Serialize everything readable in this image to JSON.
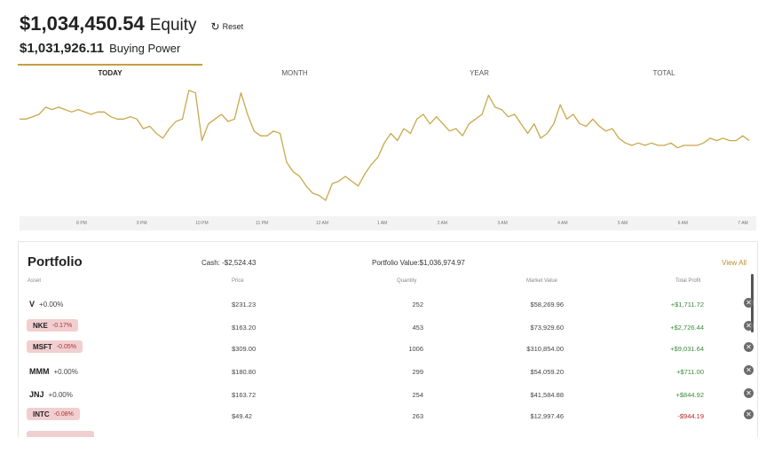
{
  "header": {
    "equity_value": "$1,034,450.54",
    "equity_label": "Equity",
    "reset_label": "Reset",
    "buying_power_value": "$1,031,926.11",
    "buying_power_label": "Buying Power"
  },
  "tabs": [
    {
      "label": "TODAY",
      "active": true
    },
    {
      "label": "MONTH",
      "active": false
    },
    {
      "label": "YEAR",
      "active": false
    },
    {
      "label": "TOTAL",
      "active": false
    }
  ],
  "chart_data": {
    "type": "line",
    "x": [
      "8 PM",
      "9 PM",
      "10 PM",
      "11 PM",
      "12 AM",
      "1 AM",
      "2 AM",
      "3 AM",
      "4 AM",
      "5 AM",
      "6 AM",
      "7 AM"
    ],
    "values": [
      40,
      40,
      41,
      42,
      45,
      44,
      45,
      44,
      43,
      44,
      43,
      42,
      43,
      43,
      41,
      40,
      40,
      41,
      40,
      36,
      37,
      34,
      32,
      36,
      39,
      40,
      52,
      51,
      31,
      38,
      40,
      42,
      39,
      40,
      51,
      42,
      35,
      33,
      33,
      35,
      34,
      22,
      18,
      16,
      12,
      9,
      8,
      6,
      13,
      14,
      16,
      14,
      12,
      17,
      21,
      24,
      30,
      34,
      31,
      36,
      34,
      40,
      42,
      38,
      41,
      38,
      35,
      36,
      33,
      38,
      40,
      42,
      50,
      45,
      44,
      41,
      42,
      38,
      34,
      38,
      32,
      34,
      38,
      46,
      40,
      42,
      38,
      37,
      40,
      37,
      35,
      36,
      32,
      30,
      29,
      30,
      29,
      30,
      29,
      29,
      30,
      28,
      29,
      29,
      29,
      30,
      32,
      31,
      32,
      31,
      31,
      33,
      31
    ],
    "color": "#c9a84c",
    "title": "",
    "xlabel": "",
    "ylabel": ""
  },
  "portfolio": {
    "title": "Portfolio",
    "cash": "Cash: -$2,524.43",
    "value": "Portfolio Value:$1,036,974.97",
    "view_all": "View All",
    "columns": {
      "asset": "Asset",
      "price": "Price",
      "quantity": "Quantity",
      "market_value": "Market Value",
      "total_profit": "Total Profit"
    },
    "rows": [
      {
        "symbol": "V",
        "change": "+0.00%",
        "highlight": false,
        "price": "$231.23",
        "quantity": "252",
        "market_value": "$58,269.96",
        "total_profit": "+$1,711.72",
        "profit_positive": true
      },
      {
        "symbol": "NKE",
        "change": "-0.17%",
        "highlight": true,
        "price": "$163.20",
        "quantity": "453",
        "market_value": "$73,929.60",
        "total_profit": "+$2,726.44",
        "profit_positive": true
      },
      {
        "symbol": "MSFT",
        "change": "-0.05%",
        "highlight": true,
        "price": "$309.00",
        "quantity": "1006",
        "market_value": "$310,854.00",
        "total_profit": "+$9,031.64",
        "profit_positive": true
      },
      {
        "symbol": "MMM",
        "change": "+0.00%",
        "highlight": false,
        "price": "$180.80",
        "quantity": "299",
        "market_value": "$54,059.20",
        "total_profit": "+$711.00",
        "profit_positive": true
      },
      {
        "symbol": "JNJ",
        "change": "+0.00%",
        "highlight": false,
        "price": "$163.72",
        "quantity": "254",
        "market_value": "$41,584.88",
        "total_profit": "+$844.92",
        "profit_positive": true
      },
      {
        "symbol": "INTC",
        "change": "-0.08%",
        "highlight": true,
        "price": "$49.42",
        "quantity": "263",
        "market_value": "$12,997.46",
        "total_profit": "-$944.19",
        "profit_positive": false
      }
    ]
  }
}
